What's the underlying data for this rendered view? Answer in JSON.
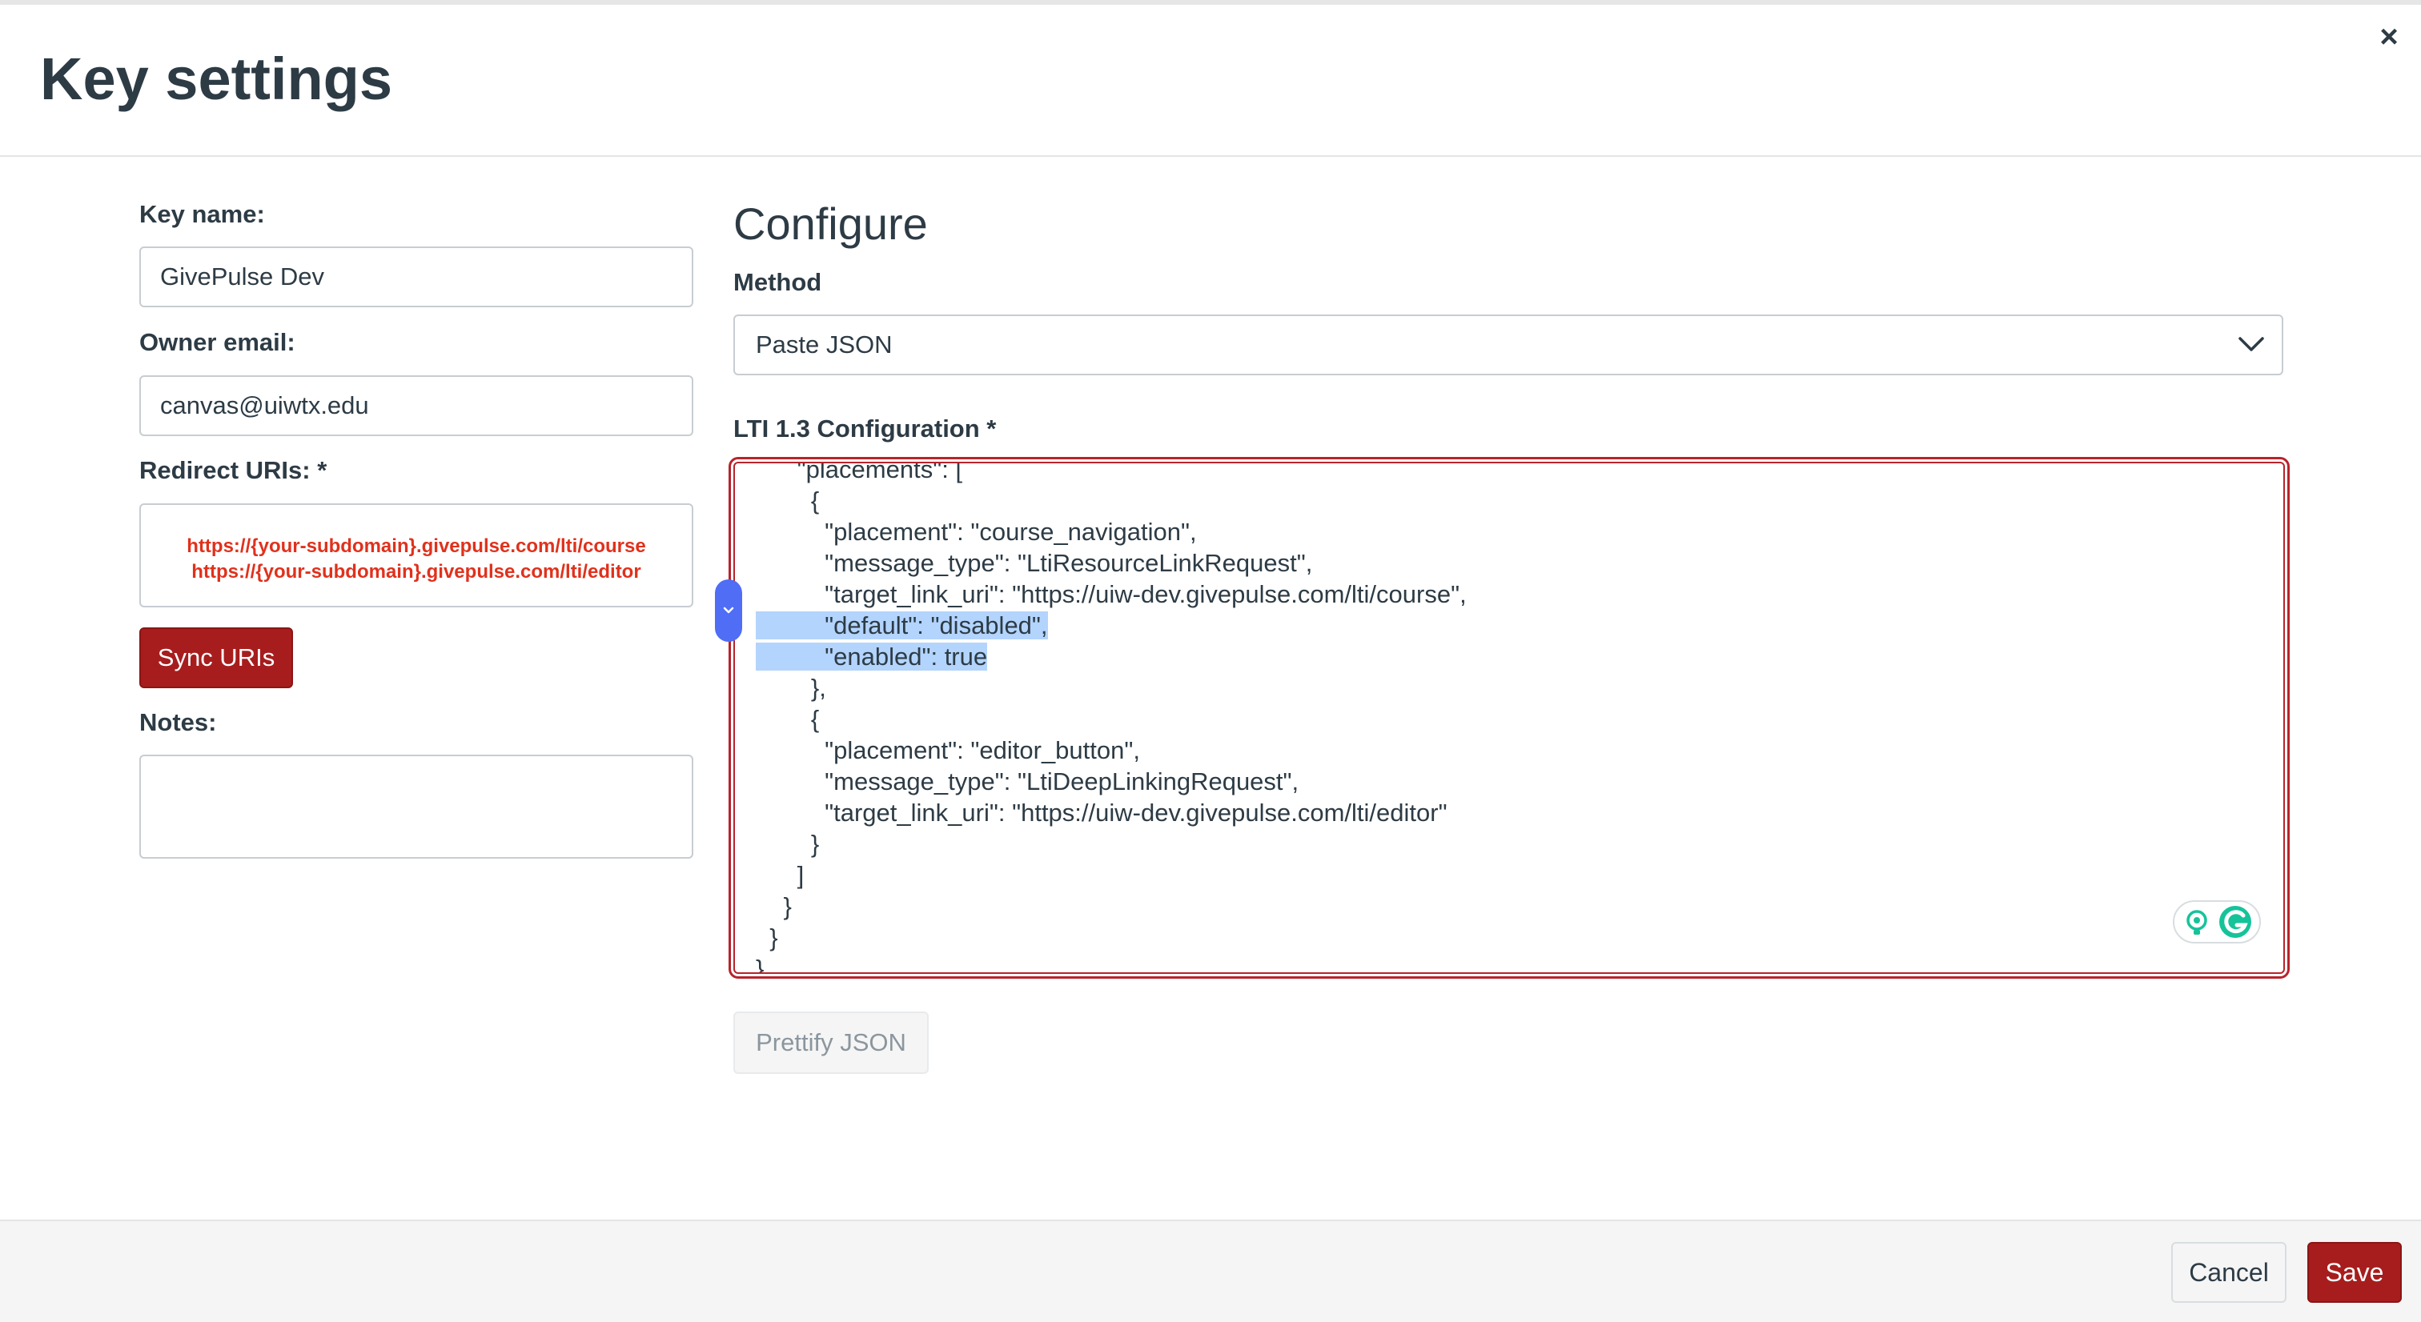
{
  "modal": {
    "title": "Key settings",
    "close_label": "×"
  },
  "left": {
    "key_name_label": "Key name:",
    "key_name_value": "GivePulse Dev",
    "owner_email_label": "Owner email:",
    "owner_email_value": "canvas@uiwtx.edu",
    "redirect_label": "Redirect URIs: *",
    "redirect_uris": [
      "https://{your-subdomain}.givepulse.com/lti/course",
      "https://{your-subdomain}.givepulse.com/lti/editor"
    ],
    "sync_button": "Sync URIs",
    "notes_label": "Notes:",
    "notes_value": ""
  },
  "configure": {
    "title": "Configure",
    "method_label": "Method",
    "method_value": "Paste JSON",
    "config_label": "LTI 1.3 Configuration *",
    "code_lines": [
      "      \"placements\": [",
      "        {",
      "          \"placement\": \"course_navigation\",",
      "          \"message_type\": \"LtiResourceLinkRequest\",",
      "          \"target_link_uri\": \"https://uiw-dev.givepulse.com/lti/course\",",
      "          \"default\": \"disabled\",",
      "          \"enabled\": true",
      "        },",
      "        {",
      "          \"placement\": \"editor_button\",",
      "          \"message_type\": \"LtiDeepLinkingRequest\",",
      "          \"target_link_uri\": \"https://uiw-dev.givepulse.com/lti/editor\"",
      "        }",
      "      ]",
      "    }",
      "  }",
      "}"
    ],
    "prettify_button": "Prettify JSON"
  },
  "footer": {
    "cancel_button": "Cancel",
    "save_button": "Save"
  },
  "colors": {
    "primary": "#a71d1d",
    "error_border": "#b8232a",
    "selection": "#b3d4fc",
    "text": "#2d3b45"
  }
}
